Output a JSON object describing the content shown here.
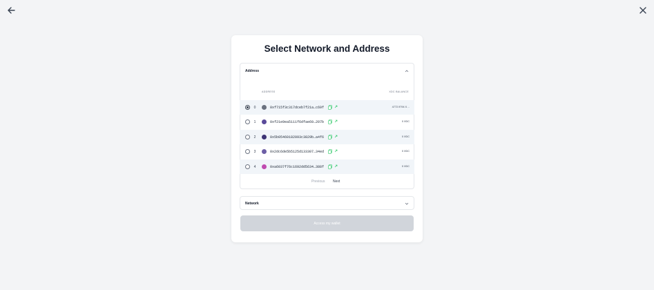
{
  "modal": {
    "title": "Select Network and Address"
  },
  "address_section": {
    "label": "Address",
    "columns": {
      "address": "ADDRESS",
      "balance": "XDC BALANCE"
    },
    "rows": [
      {
        "index": "0",
        "address": "0xf715f3c317dceb7f21a…c69f",
        "balance": "4772.9794 X…",
        "selected": true,
        "avatar_color": "#6b7280"
      },
      {
        "index": "1",
        "address": "0xf21e9ea5111f6dfae69…207b",
        "balance": "0 XDC",
        "selected": false,
        "avatar_color": "#5b4b9a"
      },
      {
        "index": "2",
        "address": "0x5b05460182093c3829b…a4f6",
        "balance": "0 XDC",
        "selected": false,
        "avatar_color": "#3d3475"
      },
      {
        "index": "3",
        "address": "0x2dc6de5b5125d133307…34ed",
        "balance": "0 XDC",
        "selected": false,
        "avatar_color": "#6d5fa6"
      },
      {
        "index": "4",
        "address": "0xa6037f76c1692dd5634…388f",
        "balance": "0 XDC",
        "selected": false,
        "avatar_color": "#c04cb0"
      }
    ],
    "pagination": {
      "previous": "Previous",
      "next": "Next"
    }
  },
  "network_section": {
    "label": "Network"
  },
  "access_button": {
    "label": "Access my wallet"
  },
  "colors": {
    "accent_copy_icon": "#22c55e",
    "accent_link_icon": "#22c55e",
    "selected_row_bg": "#f1f5f9",
    "disabled_button": "#d1d5db"
  },
  "icons": {
    "back": "arrow-left-icon",
    "close": "close-icon",
    "address_toggle": "chevron-up-icon",
    "network_toggle": "chevron-down-icon",
    "copy": "copy-icon",
    "link": "external-link-icon"
  }
}
